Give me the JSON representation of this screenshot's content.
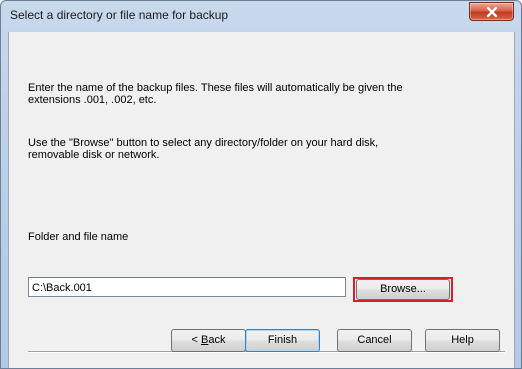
{
  "window": {
    "title": "Select a directory or file name for backup",
    "close_icon": "close-x-icon"
  },
  "body": {
    "intro_line1": "Enter the name of the backup files. These files will automatically be given the",
    "intro_line2": "extensions .001, .002, etc.",
    "browse_help_line1": "Use the \"Browse\" button to select any directory/folder on your hard disk,",
    "browse_help_line2": "removable disk or network.",
    "folder_label": "Folder and file name",
    "folder_value": "C:\\Back.001"
  },
  "buttons": {
    "browse": "Browse...",
    "back_prefix": "< ",
    "back_mnemonic": "B",
    "back_rest": "ack",
    "finish": "Finish",
    "cancel": "Cancel",
    "help": "Help"
  },
  "colors": {
    "highlight": "#d81e2a",
    "close_button": "#c03a22"
  }
}
